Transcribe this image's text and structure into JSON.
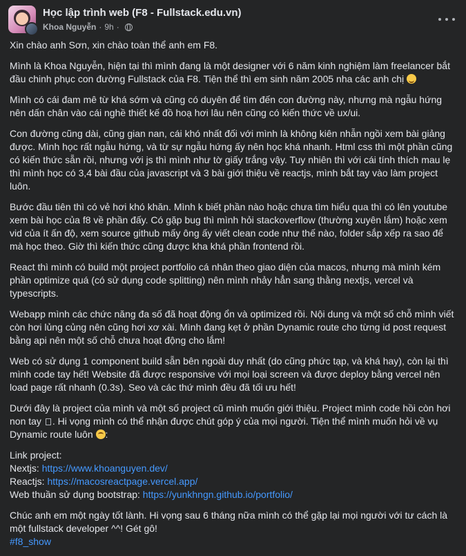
{
  "header": {
    "group_name": "Học lập trình web (F8 - Fullstack.edu.vn)",
    "author": "Khoa Nguyễn",
    "time": "9h",
    "separator": "·"
  },
  "icons": {
    "privacy": "globe-icon",
    "more": "more-options-icon"
  },
  "post": {
    "p1": "Xin chào anh Sơn, xin chào toàn thể anh em F8.",
    "p2": "Mình là Khoa Nguyễn, hiện tại thì mình đang là một designer với 6 năm kinh nghiệm làm freelancer bắt đầu chinh phục con đường Fullstack của F8. Tiện thể thì em sinh năm 2005 nha các anh chị",
    "p3": "Mình có cái đam mê từ khá sớm và cũng có duyên để tìm đến con đường này, nhưng mà ngẫu hứng nên dấn chân vào cái nghề thiết kế đồ hoạ hơi lâu nên cũng có kiến thức về ux/ui.",
    "p4": "Con đường cũng dài, cũng gian nan, cái khó nhất đối với mình là không kiên nhẫn ngồi xem bài giảng được. Mình học rất ngẫu hứng, và từ sự ngẫu hứng ấy nên học khá nhanh. Html css thì một phần cũng có kiến thức sẵn rồi, nhưng với js thì mình như tờ giấy trắng vậy. Tuy nhiên thì với cái tính thích mau lẹ thì mình học có 3,4 bài đầu của javascript và 3 bài giới thiệu về reactjs, mình bắt tay vào làm project luôn.",
    "p5": "Bước đầu tiên thì có vẻ hơi khó khăn. Mình k biết phần nào hoặc chưa tìm hiểu qua thì có lên youtube xem bài học của f8 về phần đấy. Có gặp bug thì mình hỏi stackoverflow (thường xuyên lắm) hoặc xem vid của ít ấn độ, xem source github mấy ông ấy viết clean code như thế nào, folder sắp xếp ra sao để mà học theo. Giờ thì kiến thức cũng được kha khá phần frontend rồi.",
    "p6": "React thì mình có build một project portfolio cá nhân theo giao diện của macos, nhưng mà mình kém phần optimize quá (có sử dụng code splitting) nên mình nhảy hẳn sang thằng nextjs, vercel và typescripts.",
    "p7": "Webapp mình các chức năng đa số đã hoạt động ổn và optimized rồi. Nội dung và một số chỗ mình viết còn hơi lủng củng nên cũng hơi xơ xài. Mình đang kẹt ở phần Dynamic route cho từng id post request bằng api nên một số chỗ chưa hoạt động cho lắm!",
    "p8": "Web có sử dụng 1 component build sẵn bên ngoài duy nhất (do cũng phức tạp, và khá hay), còn lại thì mình code tay hết! Website đã được responsive với mọi loại screen và được deploy bằng vercel nên load page rất nhanh (0.3s). Seo và các thứ mình đều đã tối ưu hết!",
    "p9a": "Dưới đây là project của mình và một số project cũ mình muốn giới thiệu. Project mình code hồi còn hơi non tay",
    "p9b": ". Hi vọng mình có thể nhận được chút góp ý của mọi người. Tiện thể mình muốn hỏi về vụ Dynamic route luôn",
    "p9c": ":",
    "links_heading": "Link project:",
    "link1_label": "Nextjs: ",
    "link1_url": "https://www.khoanguyen.dev/",
    "link2_label": "Reactjs: ",
    "link2_url": "https://macosreactpage.vercel.app/",
    "link3_label": "Web thuần sử dụng bootstrap: ",
    "link3_url": "https://yunkhngn.github.io/portfolio/",
    "p11": "Chúc anh em một ngày tốt lành. Hi vọng sau 6 tháng nữa mình có thể gặp lại mọi người với tư cách là một fullstack developer ^^! Gét gô!",
    "hashtag": "#f8_show"
  },
  "colors": {
    "background": "#242526",
    "text": "#e4e6eb",
    "secondary_text": "#b0b3b8",
    "link": "#4599ff"
  }
}
